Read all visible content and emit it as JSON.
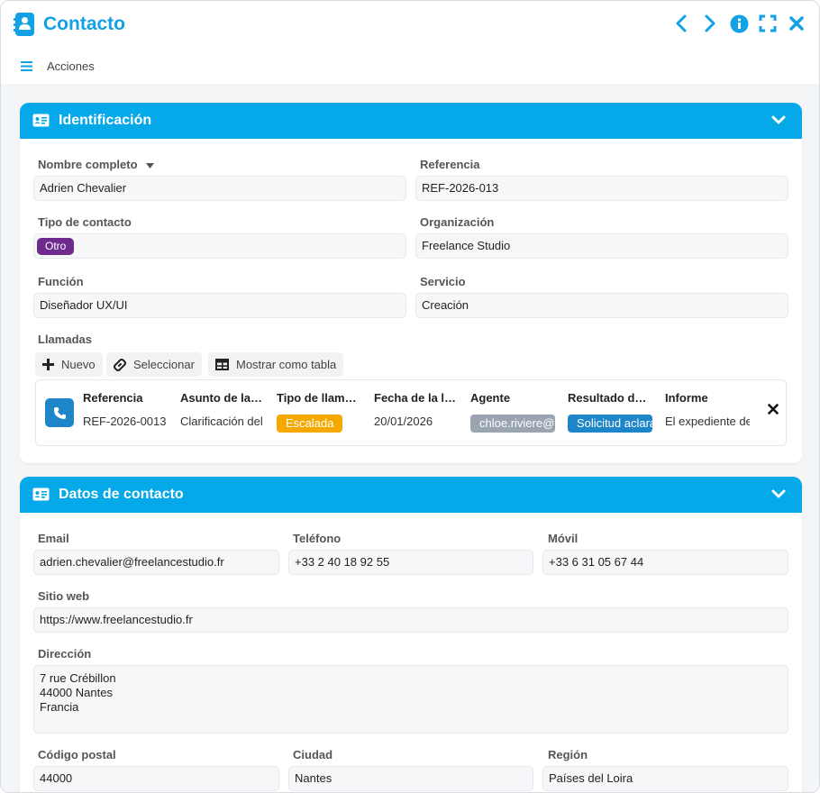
{
  "window": {
    "title": "Contacto",
    "actions_label": "Acciones",
    "accent": "#12a1e4",
    "header_blue": "#05a8e8"
  },
  "identification": {
    "title": "Identificación",
    "nombre_label": "Nombre completo",
    "nombre_value": "Adrien Chevalier",
    "referencia_label": "Referencia",
    "referencia_value": "REF-2026-013",
    "tipo_label": "Tipo de contacto",
    "tipo_value": "Otro",
    "tipo_color": "#6f2a8e",
    "organizacion_label": "Organización",
    "organizacion_value": "Freelance Studio",
    "funcion_label": "Función",
    "funcion_value": "Diseñador UX/UI",
    "servicio_label": "Servicio",
    "servicio_value": "Creación",
    "llamadas": {
      "label": "Llamadas",
      "buttons": {
        "nuevo": "Nuevo",
        "seleccionar": "Seleccionar",
        "tabla": "Mostrar como tabla"
      },
      "columns": [
        "Referencia",
        "Asunto de la llamada",
        "Tipo de llamada",
        "Fecha de la llamada",
        "Agente",
        "Resultado de la llamada",
        "Informe"
      ],
      "row": {
        "referencia": "REF-2026-0013",
        "asunto": "Clarificación del expediente",
        "tipo": "Escalada",
        "tipo_color": "#f5a800",
        "fecha": "20/01/2026",
        "agente": "chloe.riviere@",
        "agente_color": "#9aa5b1",
        "resultado": "Solicitud aclaración",
        "resultado_color": "#1e86c8",
        "informe": "El expediente del"
      }
    }
  },
  "contact": {
    "title": "Datos de contacto",
    "email_label": "Email",
    "email_value": "adrien.chevalier@freelancestudio.fr",
    "telefono_label": "Teléfono",
    "telefono_value": "+33 2 40 18 92 55",
    "movil_label": "Móvil",
    "movil_value": "+33 6 31 05 67 44",
    "web_label": "Sitio web",
    "web_value": "https://www.freelancestudio.fr",
    "direccion_label": "Dirección",
    "direccion_value": "7 rue Crébillon\n44000 Nantes\nFrancia",
    "cp_label": "Código postal",
    "cp_value": "44000",
    "ciudad_label": "Ciudad",
    "ciudad_value": "Nantes",
    "region_label": "Región",
    "region_value": "Países del Loira"
  }
}
